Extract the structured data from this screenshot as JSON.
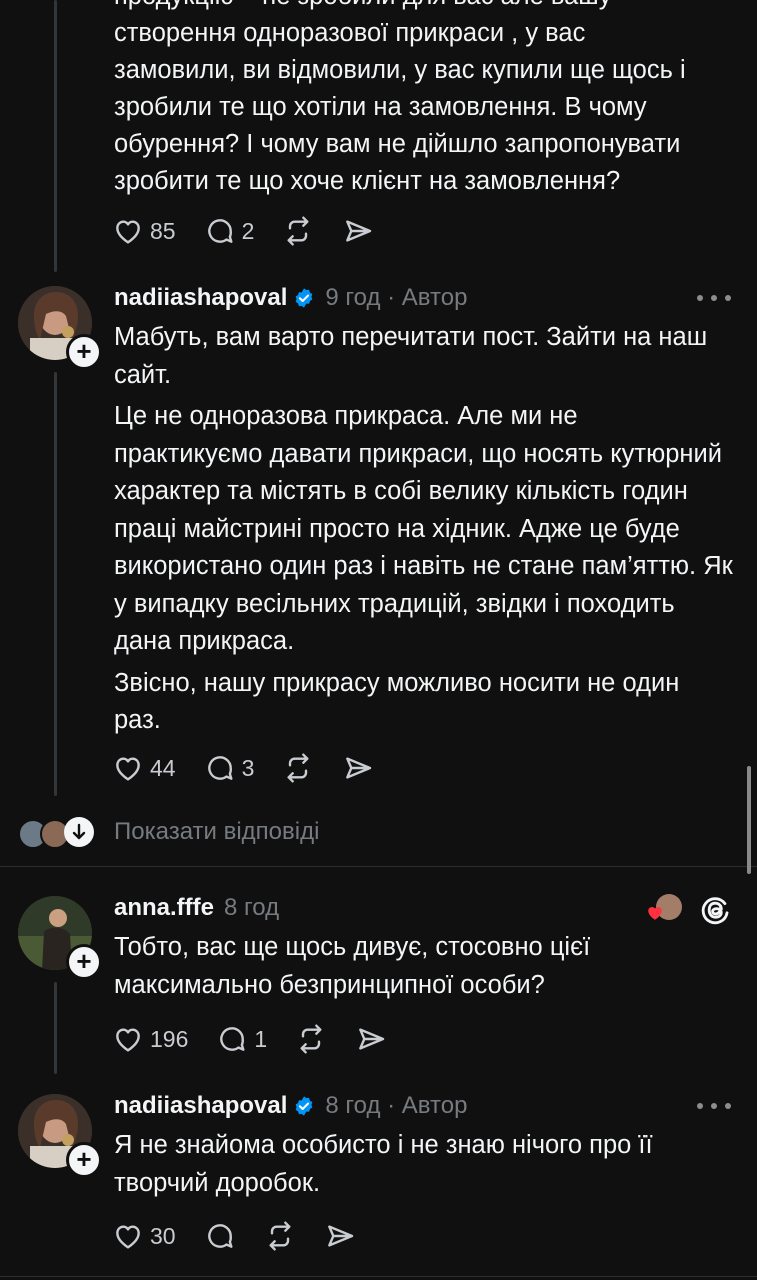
{
  "comment0": {
    "lines": [
      "продукцію – не зробили для вас але вашу",
      "створення одноразової прикраси , у вас",
      "замовили, ви відмовили, у вас купили ще щось і",
      "зробили те що хотіли на замовлення. В чому",
      "обурення? І чому вам не дійшло запропонувати",
      "зробити те що хоче клієнт на замовлення?"
    ],
    "likes": "85",
    "replies": "2"
  },
  "comment1": {
    "username": "nadiiashapoval",
    "meta": "9 год · Автор",
    "paragraphs": [
      "Мабуть, вам варто перечитати пост. Зайти на наш сайт.",
      "Це не одноразова прикраса. Але ми не практикуємо давати прикраси, що носять кутюрний характер та містять в собі велику кількість годин праці майстрині просто на хідник. Адже це буде використано один раз і навіть не стане пам’яттю. Як у випадку весільних традицій, звідки і походить дана прикраса.",
      "Звісно, нашу прикрасу можливо носити не один раз."
    ],
    "likes": "44",
    "replies": "3"
  },
  "show_replies_label": "Показати відповіді",
  "comment2": {
    "username": "anna.fffe",
    "meta": "8 год",
    "text": "Тобто, вас ще щось дивує, стосовно цієї максимально безпринципної особи?",
    "likes": "196",
    "replies": "1"
  },
  "comment3": {
    "username": "nadiiashapoval",
    "meta": "8 год · Автор",
    "text": "Я не знайома особисто і не знаю нічого про її творчий доробок.",
    "likes": "30"
  },
  "icons": {
    "like": "heart-icon",
    "reply": "comment-icon",
    "repost": "repost-icon",
    "share": "send-icon",
    "verified": "verified-badge-icon",
    "threads": "threads-logo-icon"
  },
  "colors": {
    "background": "#101010",
    "text": "#f3f5f7",
    "secondary": "#777b80",
    "verified": "#0095f6",
    "heart": "#ff3040"
  }
}
